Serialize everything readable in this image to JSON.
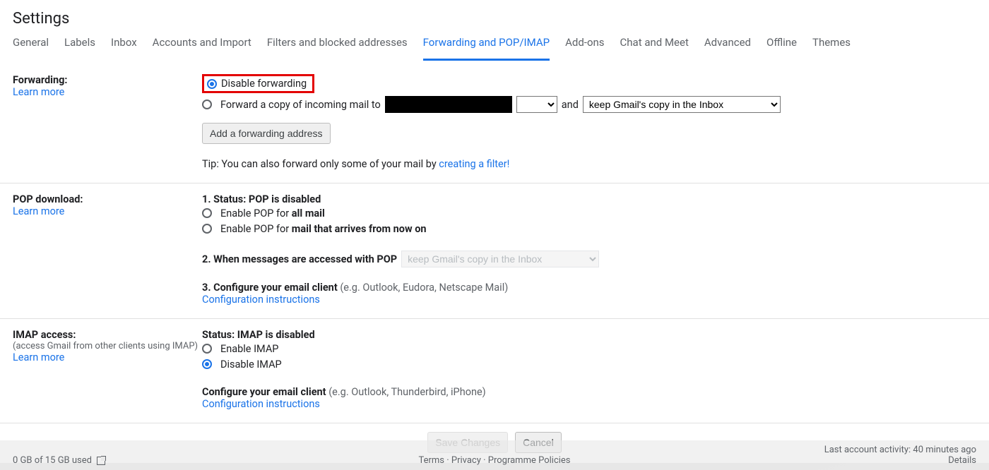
{
  "header": {
    "title": "Settings"
  },
  "tabs": [
    {
      "label": "General",
      "active": false
    },
    {
      "label": "Labels",
      "active": false
    },
    {
      "label": "Inbox",
      "active": false
    },
    {
      "label": "Accounts and Import",
      "active": false
    },
    {
      "label": "Filters and blocked addresses",
      "active": false
    },
    {
      "label": "Forwarding and POP/IMAP",
      "active": true
    },
    {
      "label": "Add-ons",
      "active": false
    },
    {
      "label": "Chat and Meet",
      "active": false
    },
    {
      "label": "Advanced",
      "active": false
    },
    {
      "label": "Offline",
      "active": false
    },
    {
      "label": "Themes",
      "active": false
    }
  ],
  "forwarding": {
    "heading": "Forwarding:",
    "learn_more": "Learn more",
    "disable_label": "Disable forwarding",
    "forward_copy_label": "Forward a copy of incoming mail to",
    "and_label": "and",
    "keep_copy_option": "keep Gmail's copy in the Inbox",
    "add_address_btn": "Add a forwarding address",
    "tip_prefix": "Tip: You can also forward only some of your mail by ",
    "tip_link": "creating a filter!"
  },
  "pop": {
    "heading": "POP download:",
    "learn_more": "Learn more",
    "status_prefix": "1. Status: ",
    "status_value": "POP is disabled",
    "enable_all_prefix": "Enable POP for ",
    "enable_all_bold": "all mail",
    "enable_now_prefix": "Enable POP for ",
    "enable_now_bold": "mail that arrives from now on",
    "when_accessed": "2. When messages are accessed with POP",
    "keep_copy_option": "keep Gmail's copy in the Inbox",
    "configure_prefix": "3. Configure your email client ",
    "configure_hint": "(e.g. Outlook, Eudora, Netscape Mail)",
    "config_link": "Configuration instructions"
  },
  "imap": {
    "heading": "IMAP access:",
    "sub": "(access Gmail from other clients using IMAP)",
    "learn_more": "Learn more",
    "status_prefix": "Status: ",
    "status_value": "IMAP is disabled",
    "enable_label": "Enable IMAP",
    "disable_label": "Disable IMAP",
    "configure_prefix": "Configure your email client ",
    "configure_hint": "(e.g. Outlook, Thunderbird, iPhone)",
    "config_link": "Configuration instructions"
  },
  "actions": {
    "save": "Save Changes",
    "cancel": "Cancel"
  },
  "footer": {
    "storage": "0 GB of 15 GB used",
    "terms": "Terms",
    "privacy": "Privacy",
    "policies": "Programme Policies",
    "activity": "Last account activity: 40 minutes ago",
    "details": "Details"
  }
}
